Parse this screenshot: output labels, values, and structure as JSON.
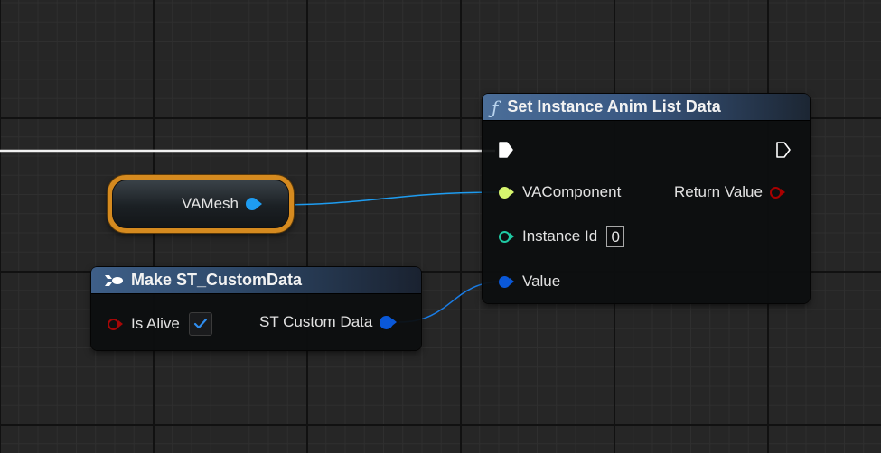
{
  "colors": {
    "exec": "#ffffff",
    "object_pin": "#1e9cf0",
    "struct_pin": "#0a58d8",
    "bool_pin": "#a50707",
    "int_pin": "#1fc9a3",
    "component_pin": "#d6f56e",
    "return_pin": "#a80000",
    "node_header": "#33507a",
    "variable_outline": "#d58a1f"
  },
  "set_instance_node": {
    "icon": "function-icon",
    "icon_glyph": "ƒ",
    "title": "Set Instance Anim List Data",
    "inputs": {
      "va_component_label": "VAComponent",
      "instance_id_label": "Instance Id",
      "instance_id_value": "0",
      "value_label": "Value"
    },
    "outputs": {
      "return_value_label": "Return Value"
    }
  },
  "vamesh_node": {
    "label": "VAMesh"
  },
  "make_struct_node": {
    "icon": "make-struct-icon",
    "title": "Make ST_CustomData",
    "is_alive_label": "Is Alive",
    "is_alive_checked": true,
    "output_label": "ST Custom Data"
  }
}
